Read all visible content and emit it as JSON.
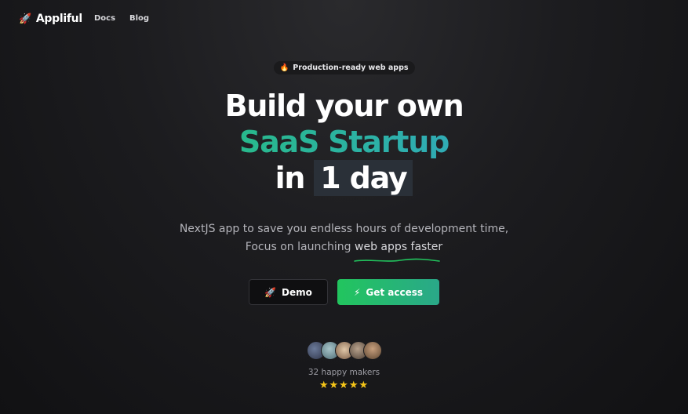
{
  "nav": {
    "brand": "Appliful",
    "brand_icon": "rocket-icon",
    "links": [
      "Docs",
      "Blog"
    ]
  },
  "badge": {
    "icon": "fire-icon",
    "text": "Production-ready web apps"
  },
  "headline": {
    "line1": "Build your own",
    "line2": "SaaS Startup",
    "line3_prefix": "in",
    "line3_highlight": "1 day"
  },
  "subtitle": {
    "line1": "NextJS app to save you endless hours of development time,",
    "line2_prefix": "Focus on launching",
    "line2_underlined": "web apps faster"
  },
  "buttons": {
    "demo": {
      "icon": "rocket-icon",
      "label": "Demo"
    },
    "access": {
      "icon": "lightning-icon",
      "label": "Get access"
    }
  },
  "social_proof": {
    "makers_text": "32 happy makers",
    "rating": 5,
    "stars": "★★★★★"
  },
  "colors": {
    "accent_green": "#22c55e",
    "accent_blue": "#3b9ae6",
    "star": "#f5c518"
  }
}
